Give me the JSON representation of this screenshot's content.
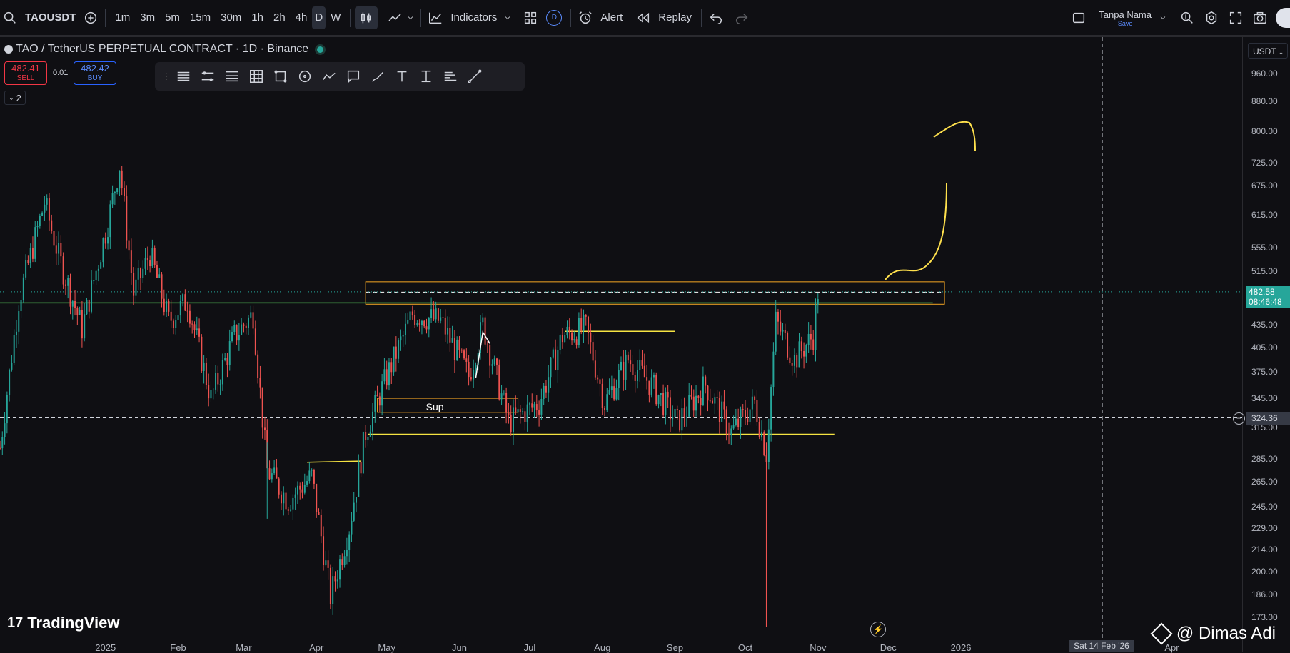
{
  "toolbar": {
    "symbol": "TAOUSDT",
    "intervals": [
      "1m",
      "3m",
      "5m",
      "15m",
      "30m",
      "1h",
      "2h",
      "4h",
      "D",
      "W"
    ],
    "active_interval": "D",
    "indicators_label": "Indicators",
    "alert_label": "Alert",
    "replay_label": "Replay",
    "layout_name": "Tanpa Nama",
    "layout_save": "Save",
    "d_badge": "D"
  },
  "legend": {
    "title": "TAO / TetherUS PERPETUAL CONTRACT · 1D · Binance",
    "sell_price": "482.41",
    "sell_label": "SELL",
    "buy_price": "482.42",
    "buy_label": "BUY",
    "spread": "0.01",
    "collapse_count": "2"
  },
  "branding": {
    "logo_text": "TradingView",
    "watermark": "@ Dimas Adi"
  },
  "price_axis": {
    "currency": "USDT",
    "current_price": "482.58",
    "countdown": "08:46:48",
    "crosshair_price": "324.36"
  },
  "crosshair_date": "Sat 14 Feb '26",
  "annotations": {
    "sup_label": "Sup"
  },
  "colors": {
    "up": "#26a69a",
    "down": "#ef5350",
    "zone": "#f5a623",
    "support": "#f5e342",
    "green_line": "#4caf50",
    "background": "#0f0f13"
  },
  "chart_data": {
    "type": "candlestick",
    "title": "",
    "symbol": "TAO / TetherUS PERPETUAL CONTRACT",
    "interval": "1D",
    "exchange": "Binance",
    "y_scale": "log",
    "ylim": [
      165,
      1000
    ],
    "y_ticks": [
      960,
      880,
      800,
      725,
      675,
      615,
      555,
      515,
      435,
      405,
      375,
      345,
      315,
      285,
      265,
      245,
      229,
      214,
      200,
      186,
      173
    ],
    "x_ticks": [
      "2025",
      "Feb",
      "Mar",
      "Apr",
      "May",
      "Jun",
      "Jul",
      "Aug",
      "Sep",
      "Oct",
      "Nov",
      "Dec",
      "2026",
      "Apr"
    ],
    "x_tick_dates": [
      "2025-01-01",
      "2025-02-01",
      "2025-03-01",
      "2025-04-01",
      "2025-05-01",
      "2025-06-01",
      "2025-07-01",
      "2025-08-01",
      "2025-09-01",
      "2025-10-01",
      "2025-11-01",
      "2025-12-01",
      "2026-01-01",
      "2026-04-01"
    ],
    "x_range": [
      "2024-11-17",
      "2026-05-01"
    ],
    "last_price": 482.58,
    "key_levels": {
      "resistance_zone": [
        464,
        498
      ],
      "green_line": 466,
      "support_line": 308,
      "crosshair": 324.36
    },
    "price_path": [
      {
        "date": "2024-11-17",
        "price": 295
      },
      {
        "date": "2024-11-25",
        "price": 470
      },
      {
        "date": "2024-12-06",
        "price": 640
      },
      {
        "date": "2024-12-12",
        "price": 540
      },
      {
        "date": "2024-12-22",
        "price": 430
      },
      {
        "date": "2025-01-02",
        "price": 600
      },
      {
        "date": "2025-01-07",
        "price": 720
      },
      {
        "date": "2025-01-13",
        "price": 480
      },
      {
        "date": "2025-01-20",
        "price": 545
      },
      {
        "date": "2025-01-28",
        "price": 440
      },
      {
        "date": "2025-02-05",
        "price": 470
      },
      {
        "date": "2025-02-15",
        "price": 345
      },
      {
        "date": "2025-02-25",
        "price": 420
      },
      {
        "date": "2025-03-05",
        "price": 450
      },
      {
        "date": "2025-03-11",
        "price": 275
      },
      {
        "date": "2025-03-20",
        "price": 250
      },
      {
        "date": "2025-03-30",
        "price": 270
      },
      {
        "date": "2025-04-07",
        "price": 185
      },
      {
        "date": "2025-04-15",
        "price": 230
      },
      {
        "date": "2025-04-22",
        "price": 310
      },
      {
        "date": "2025-05-01",
        "price": 370
      },
      {
        "date": "2025-05-12",
        "price": 450
      },
      {
        "date": "2025-05-24",
        "price": 440
      },
      {
        "date": "2025-06-05",
        "price": 370
      },
      {
        "date": "2025-06-11",
        "price": 435
      },
      {
        "date": "2025-06-22",
        "price": 320
      },
      {
        "date": "2025-07-05",
        "price": 340
      },
      {
        "date": "2025-07-15",
        "price": 420
      },
      {
        "date": "2025-07-25",
        "price": 430
      },
      {
        "date": "2025-08-02",
        "price": 340
      },
      {
        "date": "2025-08-12",
        "price": 390
      },
      {
        "date": "2025-08-22",
        "price": 360
      },
      {
        "date": "2025-09-02",
        "price": 320
      },
      {
        "date": "2025-09-14",
        "price": 360
      },
      {
        "date": "2025-09-25",
        "price": 310
      },
      {
        "date": "2025-10-05",
        "price": 340
      },
      {
        "date": "2025-10-10",
        "price": 290
      },
      {
        "date": "2025-10-14",
        "price": 440
      },
      {
        "date": "2025-10-22",
        "price": 390
      },
      {
        "date": "2025-10-30",
        "price": 420
      },
      {
        "date": "2025-11-01",
        "price": 482.58
      }
    ]
  }
}
